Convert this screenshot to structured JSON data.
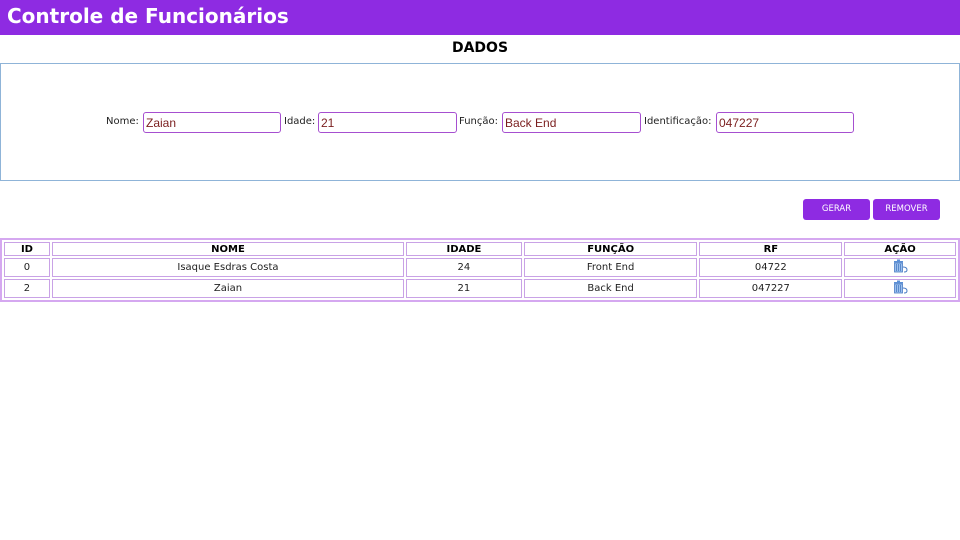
{
  "header": {
    "title": "Controle de Funcionários"
  },
  "section": {
    "title": "DADOS"
  },
  "form": {
    "nome_label": "Nome:",
    "nome_value": "Zaian",
    "idade_label": "Idade:",
    "idade_value": "21",
    "funcao_label": "Função:",
    "funcao_value": "Back End",
    "identificacao_label": "Identificação:",
    "identificacao_value": "047227"
  },
  "actions": {
    "gerar_label": "GERAR",
    "remover_label": "REMOVER"
  },
  "table": {
    "headers": [
      "ID",
      "NOME",
      "IDADE",
      "FUNÇÃO",
      "RF",
      "AÇÃO"
    ],
    "rows": [
      {
        "id": "0",
        "nome": "Isaque Esdras Costa",
        "idade": "24",
        "funcao": "Front End",
        "rf": "04722",
        "acao_icon": "trash-icon"
      },
      {
        "id": "2",
        "nome": "Zaian",
        "idade": "21",
        "funcao": "Back End",
        "rf": "047227",
        "acao_icon": "trash-icon"
      }
    ]
  },
  "colors": {
    "primary": "#8e2be2",
    "input_border": "#a64fd0",
    "table_border": "#c9a2e6",
    "form_border": "#8fb4d8"
  }
}
